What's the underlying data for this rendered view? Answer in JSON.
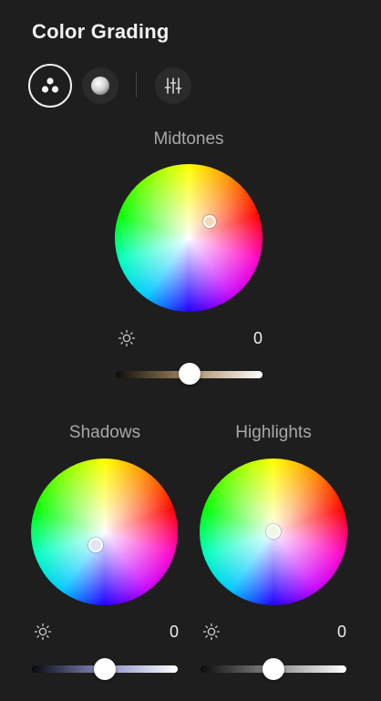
{
  "panel": {
    "title": "Color Grading"
  },
  "modes": [
    {
      "name": "three-way",
      "icon": "three-dots-icon",
      "active": true
    },
    {
      "name": "single",
      "icon": "sphere-icon",
      "active": false
    },
    {
      "name": "adjust",
      "icon": "sliders-icon",
      "active": false
    }
  ],
  "midtones": {
    "label": "Midtones",
    "luminance_value": "0",
    "slider_level": 0.5,
    "slider_colors": [
      "#0f0d0a",
      "#a68a64",
      "#ffffff"
    ]
  },
  "shadows": {
    "label": "Shadows",
    "luminance_value": "0",
    "slider_level": 0.5,
    "slider_colors": [
      "#080812",
      "#8a8fc8",
      "#ffffff"
    ]
  },
  "highlights": {
    "label": "Highlights",
    "luminance_value": "0",
    "slider_level": 0.5,
    "slider_colors": [
      "#0c0c0c",
      "#8a8a8a",
      "#ffffff"
    ]
  },
  "icons": {
    "luminance": "sun-icon"
  },
  "colors": {
    "background": "#1e1e1e",
    "button_bg": "#2b2b2b",
    "text_muted": "#a8a8a8"
  }
}
